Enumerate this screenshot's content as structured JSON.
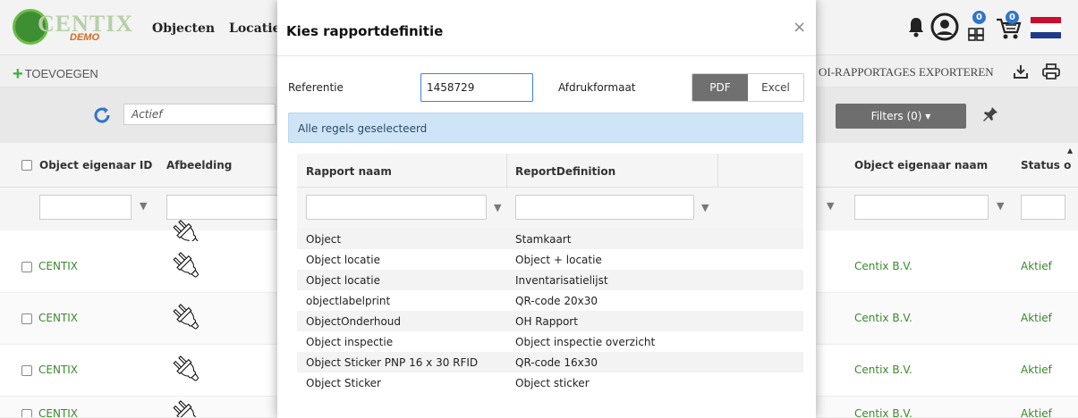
{
  "app": {
    "logo_text": "CENTIX",
    "logo_sub": "DEMO",
    "nav": [
      "Objecten",
      "Locaties"
    ],
    "notifications_count": "0",
    "cart_count": "0",
    "add_label": "TOEVOEGEN",
    "export_label": "OI-RAPPORTAGES EXPORTEREN",
    "status_filter": "Actief",
    "filters_label": "Filters (0)",
    "columns": {
      "owner_id": "Object eigenaar ID",
      "image": "Afbeelding",
      "owner_name": "Object eigenaar naam",
      "status": "Status o"
    },
    "rows": [
      {
        "owner_id": "CENTIX",
        "owner_name": "Centix B.V.",
        "status": "Aktief"
      },
      {
        "owner_id": "CENTIX",
        "owner_name": "Centix B.V.",
        "status": "Aktief"
      },
      {
        "owner_id": "CENTIX",
        "owner_name": "Centix B.V.",
        "status": "Aktief"
      },
      {
        "owner_id": "CENTIX",
        "owner_name": "Centix B.V.",
        "status": "Aktief"
      }
    ]
  },
  "modal": {
    "title": "Kies rapportdefinitie",
    "close": "×",
    "reference_label": "Referentie",
    "reference_value": "1458729",
    "format_label": "Afdrukformaat",
    "format_options": [
      "PDF",
      "Excel"
    ],
    "format_selected": "PDF",
    "info_text": "Alle regels geselecteerd",
    "columns": {
      "report_name": "Rapport naam",
      "report_definition": "ReportDefinition"
    },
    "rows": [
      {
        "name": "Object",
        "definition": "Stamkaart"
      },
      {
        "name": "Object locatie",
        "definition": "Object + locatie"
      },
      {
        "name": "Object locatie",
        "definition": "Inventarisatielijst"
      },
      {
        "name": "objectlabelprint",
        "definition": "QR-code 20x30"
      },
      {
        "name": "ObjectOnderhoud",
        "definition": "OH Rapport"
      },
      {
        "name": "Object inspectie",
        "definition": "Object inspectie overzicht"
      },
      {
        "name": "Object Sticker PNP 16 x 30 RFID",
        "definition": "QR-code 16x30"
      },
      {
        "name": "Object Sticker",
        "definition": "Object sticker"
      }
    ]
  },
  "colors": {
    "accent_blue": "#2f74c9",
    "brand_green": "#3a8a2c",
    "info_bg": "#cfe5f7",
    "segment_active": "#707070"
  }
}
